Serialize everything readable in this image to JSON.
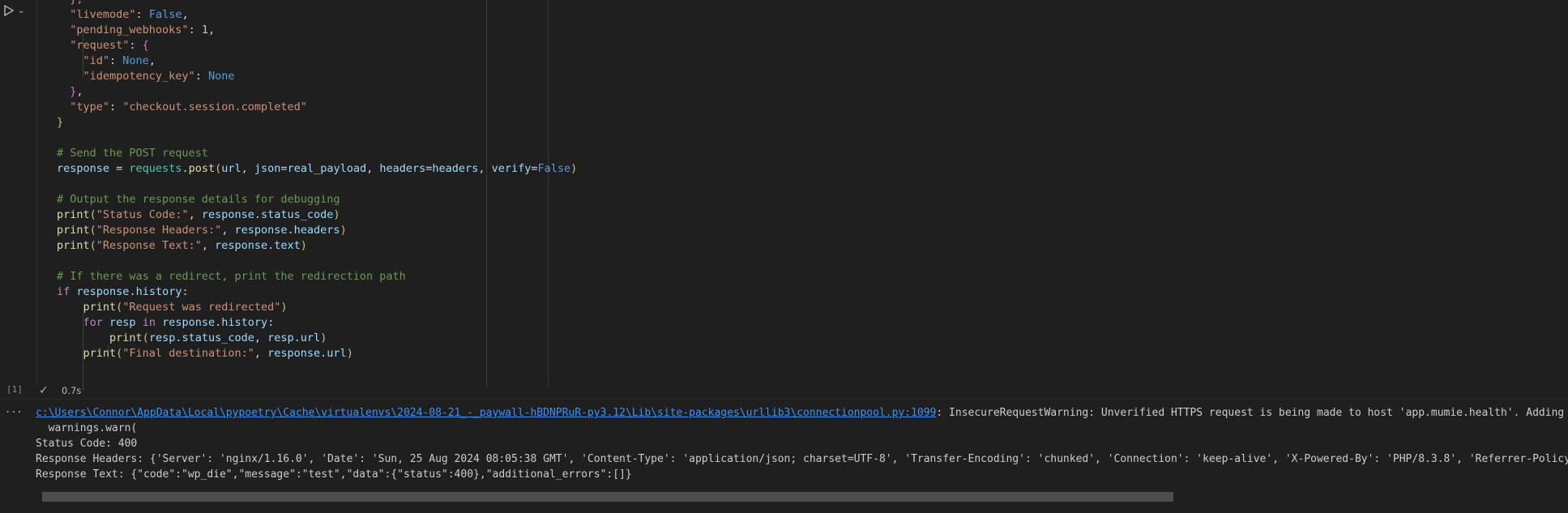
{
  "cell": {
    "execution_count": "[1]",
    "status_time": "0.7s",
    "code_lines": [
      [
        {
          "c": "tok-ctrl",
          "t": "  },"
        }
      ],
      [
        {
          "c": "tok-key",
          "t": "  \"livemode\""
        },
        {
          "c": "tok-plain",
          "t": ": "
        },
        {
          "c": "tok-kw",
          "t": "False"
        },
        {
          "c": "tok-plain",
          "t": ","
        }
      ],
      [
        {
          "c": "tok-key",
          "t": "  \"pending_webhooks\""
        },
        {
          "c": "tok-plain",
          "t": ": "
        },
        {
          "c": "tok-num",
          "t": "1"
        },
        {
          "c": "tok-plain",
          "t": ","
        }
      ],
      [
        {
          "c": "tok-key",
          "t": "  \"request\""
        },
        {
          "c": "tok-plain",
          "t": ": "
        },
        {
          "c": "tok-brace2",
          "t": "{"
        }
      ],
      [
        {
          "c": "tok-key",
          "t": "    \"id\""
        },
        {
          "c": "tok-plain",
          "t": ": "
        },
        {
          "c": "tok-kw",
          "t": "None"
        },
        {
          "c": "tok-plain",
          "t": ","
        }
      ],
      [
        {
          "c": "tok-key",
          "t": "    \"idempotency_key\""
        },
        {
          "c": "tok-plain",
          "t": ": "
        },
        {
          "c": "tok-kw",
          "t": "None"
        }
      ],
      [
        {
          "c": "tok-brace2",
          "t": "  }"
        },
        {
          "c": "tok-plain",
          "t": ","
        }
      ],
      [
        {
          "c": "tok-key",
          "t": "  \"type\""
        },
        {
          "c": "tok-plain",
          "t": ": "
        },
        {
          "c": "tok-str",
          "t": "\"checkout.session.completed\""
        }
      ],
      [
        {
          "c": "tok-brace",
          "t": "}"
        }
      ],
      [],
      [
        {
          "c": "tok-com",
          "t": "# Send the POST request"
        }
      ],
      [
        {
          "c": "tok-var",
          "t": "response"
        },
        {
          "c": "tok-plain",
          "t": " = "
        },
        {
          "c": "tok-mod",
          "t": "requests"
        },
        {
          "c": "tok-plain",
          "t": "."
        },
        {
          "c": "tok-fn",
          "t": "post"
        },
        {
          "c": "tok-brace",
          "t": "("
        },
        {
          "c": "tok-var",
          "t": "url"
        },
        {
          "c": "tok-plain",
          "t": ", "
        },
        {
          "c": "tok-var",
          "t": "json"
        },
        {
          "c": "tok-plain",
          "t": "="
        },
        {
          "c": "tok-var",
          "t": "real_payload"
        },
        {
          "c": "tok-plain",
          "t": ", "
        },
        {
          "c": "tok-var",
          "t": "headers"
        },
        {
          "c": "tok-plain",
          "t": "="
        },
        {
          "c": "tok-var",
          "t": "headers"
        },
        {
          "c": "tok-plain",
          "t": ", "
        },
        {
          "c": "tok-var",
          "t": "verify"
        },
        {
          "c": "tok-plain",
          "t": "="
        },
        {
          "c": "tok-kw",
          "t": "False"
        },
        {
          "c": "tok-brace",
          "t": ")"
        }
      ],
      [],
      [
        {
          "c": "tok-com",
          "t": "# Output the response details for debugging"
        }
      ],
      [
        {
          "c": "tok-fn",
          "t": "print"
        },
        {
          "c": "tok-brace",
          "t": "("
        },
        {
          "c": "tok-str",
          "t": "\"Status Code:\""
        },
        {
          "c": "tok-plain",
          "t": ", "
        },
        {
          "c": "tok-var",
          "t": "response"
        },
        {
          "c": "tok-plain",
          "t": "."
        },
        {
          "c": "tok-var",
          "t": "status_code"
        },
        {
          "c": "tok-brace",
          "t": ")"
        }
      ],
      [
        {
          "c": "tok-fn",
          "t": "print"
        },
        {
          "c": "tok-brace",
          "t": "("
        },
        {
          "c": "tok-str",
          "t": "\"Response Headers:\""
        },
        {
          "c": "tok-plain",
          "t": ", "
        },
        {
          "c": "tok-var",
          "t": "response"
        },
        {
          "c": "tok-plain",
          "t": "."
        },
        {
          "c": "tok-var",
          "t": "headers"
        },
        {
          "c": "tok-brace",
          "t": ")"
        }
      ],
      [
        {
          "c": "tok-fn",
          "t": "print"
        },
        {
          "c": "tok-brace",
          "t": "("
        },
        {
          "c": "tok-str",
          "t": "\"Response Text:\""
        },
        {
          "c": "tok-plain",
          "t": ", "
        },
        {
          "c": "tok-var",
          "t": "response"
        },
        {
          "c": "tok-plain",
          "t": "."
        },
        {
          "c": "tok-var",
          "t": "text"
        },
        {
          "c": "tok-brace",
          "t": ")"
        }
      ],
      [],
      [
        {
          "c": "tok-com",
          "t": "# If there was a redirect, print the redirection path"
        }
      ],
      [
        {
          "c": "tok-ctrl",
          "t": "if"
        },
        {
          "c": "tok-plain",
          "t": " "
        },
        {
          "c": "tok-var",
          "t": "response"
        },
        {
          "c": "tok-plain",
          "t": "."
        },
        {
          "c": "tok-var",
          "t": "history"
        },
        {
          "c": "tok-plain",
          "t": ":"
        }
      ],
      [
        {
          "c": "tok-plain",
          "t": "    "
        },
        {
          "c": "tok-fn",
          "t": "print"
        },
        {
          "c": "tok-brace",
          "t": "("
        },
        {
          "c": "tok-str",
          "t": "\"Request was redirected\""
        },
        {
          "c": "tok-brace",
          "t": ")"
        }
      ],
      [
        {
          "c": "tok-plain",
          "t": "    "
        },
        {
          "c": "tok-ctrl",
          "t": "for"
        },
        {
          "c": "tok-plain",
          "t": " "
        },
        {
          "c": "tok-var",
          "t": "resp"
        },
        {
          "c": "tok-plain",
          "t": " "
        },
        {
          "c": "tok-ctrl",
          "t": "in"
        },
        {
          "c": "tok-plain",
          "t": " "
        },
        {
          "c": "tok-var",
          "t": "response"
        },
        {
          "c": "tok-plain",
          "t": "."
        },
        {
          "c": "tok-var",
          "t": "history"
        },
        {
          "c": "tok-plain",
          "t": ":"
        }
      ],
      [
        {
          "c": "tok-plain",
          "t": "        "
        },
        {
          "c": "tok-fn",
          "t": "print"
        },
        {
          "c": "tok-brace",
          "t": "("
        },
        {
          "c": "tok-var",
          "t": "resp"
        },
        {
          "c": "tok-plain",
          "t": "."
        },
        {
          "c": "tok-var",
          "t": "status_code"
        },
        {
          "c": "tok-plain",
          "t": ", "
        },
        {
          "c": "tok-var",
          "t": "resp"
        },
        {
          "c": "tok-plain",
          "t": "."
        },
        {
          "c": "tok-var",
          "t": "url"
        },
        {
          "c": "tok-brace",
          "t": ")"
        }
      ],
      [
        {
          "c": "tok-plain",
          "t": "    "
        },
        {
          "c": "tok-fn",
          "t": "print"
        },
        {
          "c": "tok-brace",
          "t": "("
        },
        {
          "c": "tok-str",
          "t": "\"Final destination:\""
        },
        {
          "c": "tok-plain",
          "t": ", "
        },
        {
          "c": "tok-var",
          "t": "response"
        },
        {
          "c": "tok-plain",
          "t": "."
        },
        {
          "c": "tok-var",
          "t": "url"
        },
        {
          "c": "tok-brace",
          "t": ")"
        }
      ]
    ]
  },
  "output": {
    "more_label": "...",
    "warning_path": "c:\\Users\\Connor\\AppData\\Local\\pypoetry\\Cache\\virtualenvs\\2024-08-21_-_paywall-hBDNPRuR-py3.12\\Lib\\site-packages\\urllib3\\connectionpool.py:1099",
    "warning_text": ": InsecureRequestWarning: Unverified HTTPS request is being made to host 'app.mumie.health'. Adding cert",
    "lines": [
      "  warnings.warn(",
      "Status Code: 400",
      "Response Headers: {'Server': 'nginx/1.16.0', 'Date': 'Sun, 25 Aug 2024 08:05:38 GMT', 'Content-Type': 'application/json; charset=UTF-8', 'Transfer-Encoding': 'chunked', 'Connection': 'keep-alive', 'X-Powered-By': 'PHP/8.3.8', 'Referrer-Policy': '",
      "Response Text: {\"code\":\"wp_die\",\"message\":\"test\",\"data\":{\"status\":400},\"additional_errors\":[]}"
    ]
  }
}
